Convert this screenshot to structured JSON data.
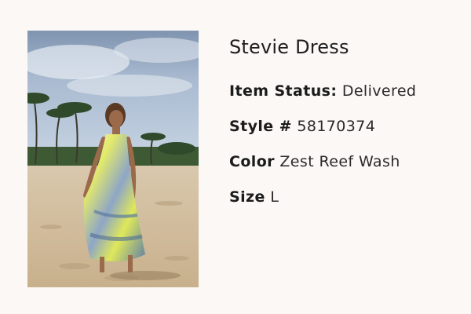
{
  "product": {
    "name": "Stevie Dress",
    "image_alt": "Model wearing the Stevie Dress on a tropical beach",
    "status": {
      "label": "Item Status:",
      "value": "Delivered"
    },
    "style": {
      "label": "Style #",
      "value": "58170374"
    },
    "color": {
      "label": "Color",
      "value": "Zest Reef Wash"
    },
    "size": {
      "label": "Size",
      "value": "L"
    }
  },
  "colors": {
    "background": "#fbf8f6",
    "text": "#1f1f1f",
    "dress_yellow": "#e8ec5a",
    "dress_blue": "#5d7ba3"
  }
}
